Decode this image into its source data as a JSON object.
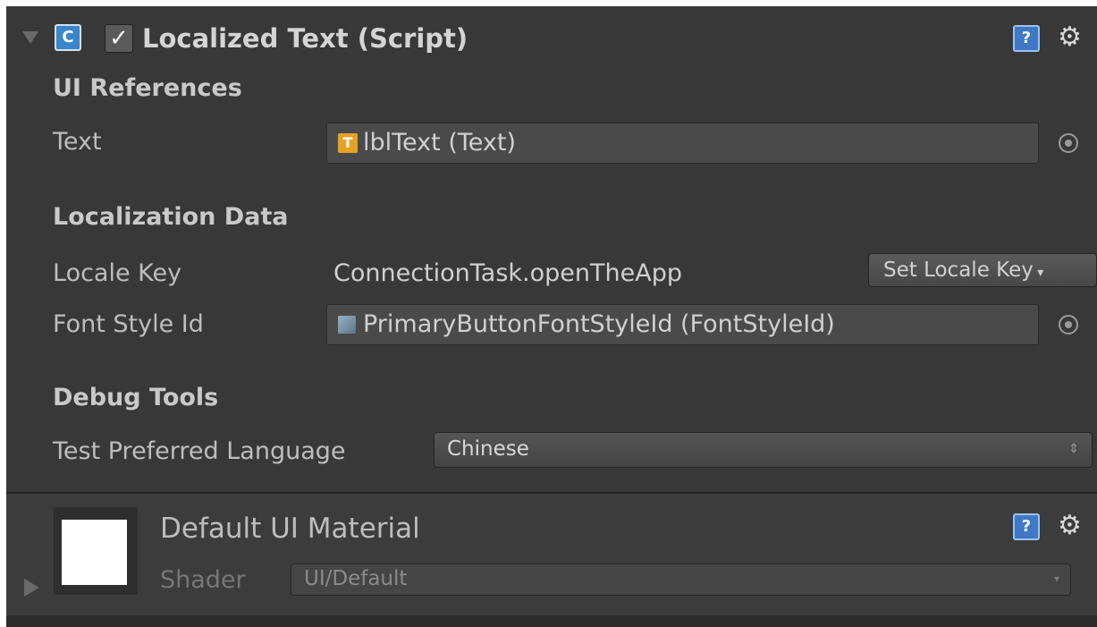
{
  "component": {
    "title": "Localized Text (Script)",
    "enabled": true,
    "sections": {
      "ui_references": {
        "header": "UI References",
        "text_label": "Text",
        "text_value": "lblText (Text)"
      },
      "localization_data": {
        "header": "Localization Data",
        "locale_key_label": "Locale Key",
        "locale_key_value": "ConnectionTask.openTheApp",
        "set_locale_key_button": "Set Locale Key",
        "font_style_label": "Font Style Id",
        "font_style_value": "PrimaryButtonFontStyleId (FontStyleId)"
      },
      "debug_tools": {
        "header": "Debug Tools",
        "language_label": "Test Preferred Language",
        "language_value": "Chinese"
      }
    }
  },
  "material": {
    "name": "Default UI Material",
    "shader_label": "Shader",
    "shader_value": "UI/Default"
  },
  "icons": {
    "foldout": "triangle-down-icon",
    "script": "csharp-script-icon",
    "help": "help-book-icon",
    "settings": "gear-icon",
    "text_ref": "text-component-icon",
    "font_style_ref": "scriptable-object-icon",
    "object_picker": "object-picker-icon"
  },
  "colors": {
    "panel": "#383838",
    "field": "#4a4a4a",
    "text_icon": "#e6a224",
    "help_icon": "#3f79c6"
  }
}
